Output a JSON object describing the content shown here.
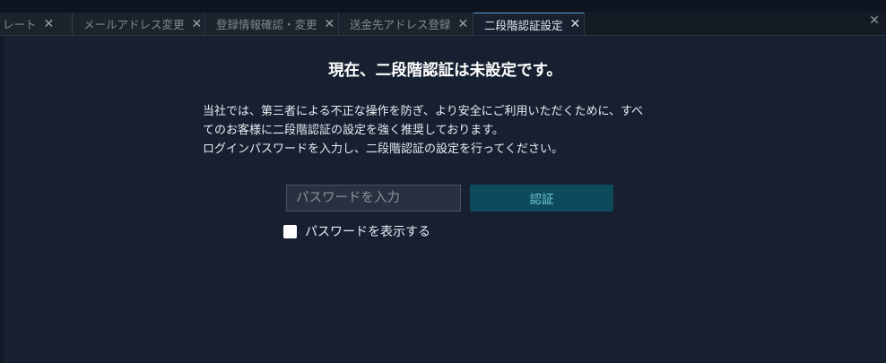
{
  "tabs": [
    {
      "label": "レート",
      "close": "✕"
    },
    {
      "label": "メールアドレス変更",
      "close": "✕"
    },
    {
      "label": "登録情報確認・変更",
      "close": "✕"
    },
    {
      "label": "送金先アドレス登録",
      "close": "✕"
    },
    {
      "label": "二段階認証設定",
      "close": "✕",
      "active": true
    }
  ],
  "window": {
    "close": "✕"
  },
  "main": {
    "title": "現在、二段階認証は未設定です。",
    "description": [
      "当社では、第三者による不正な操作を防ぎ、より安全にご利用いただくために、すべ",
      "てのお客様に二段階認証の設定を強く推奨しております。",
      "ログインパスワードを入力し、二段階認証の設定を行ってください。"
    ],
    "password_placeholder": "パスワードを入力",
    "password_value": "",
    "submit_label": "認証",
    "show_password_label": "パスワードを表示する"
  },
  "colors": {
    "accent_tab_border": "#5aa0d0",
    "button_bg": "#0d4a5c",
    "button_text": "#6fc6db"
  }
}
